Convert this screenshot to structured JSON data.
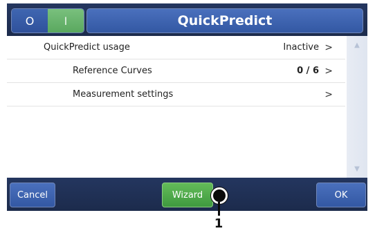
{
  "header": {
    "toggle_off_label": "O",
    "toggle_on_label": "I",
    "title": "QuickPredict"
  },
  "rows": [
    {
      "label": "QuickPredict usage",
      "value": "Inactive",
      "chevron": ">"
    },
    {
      "label": "Reference Curves",
      "value": "0 / 6",
      "chevron": ">"
    },
    {
      "label": "Measurement settings",
      "value": "",
      "chevron": ">"
    }
  ],
  "scrollbar": {
    "up_glyph": "▲",
    "down_glyph": "▼"
  },
  "footer": {
    "cancel_label": "Cancel",
    "wizard_label": "Wizard",
    "ok_label": "OK"
  },
  "callout": {
    "number": "1"
  },
  "colors": {
    "header_bg": "#24365f",
    "title_blue": "#3f66b1",
    "toggle_green": "#5aa85f",
    "wizard_green": "#3f9a3f"
  }
}
